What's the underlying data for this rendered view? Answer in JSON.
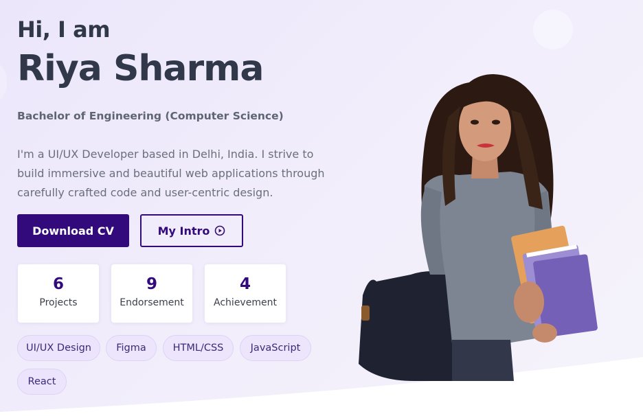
{
  "hero": {
    "greeting": "Hi, I am",
    "name": "Riya Sharma",
    "degree": "Bachelor of Engineering (Computer Science)",
    "bio": "I'm a UI/UX Developer based in Delhi, India. I strive to build immersive and beautiful web applications through carefully crafted code and user-centric design."
  },
  "buttons": {
    "download_cv": "Download CV",
    "my_intro": "My Intro",
    "my_intro_icon": "play-circle-icon"
  },
  "stats": [
    {
      "value": "6",
      "label": "Projects"
    },
    {
      "value": "9",
      "label": "Endorsement"
    },
    {
      "value": "4",
      "label": "Achievement"
    }
  ],
  "skills": [
    "UI/UX Design",
    "Figma",
    "HTML/CSS",
    "JavaScript",
    "React"
  ],
  "colors": {
    "primary": "#320a7c",
    "heading": "#30384a",
    "text": "#6a6f7c",
    "background": "#efeafb",
    "tag_background": "#eae2fc"
  }
}
